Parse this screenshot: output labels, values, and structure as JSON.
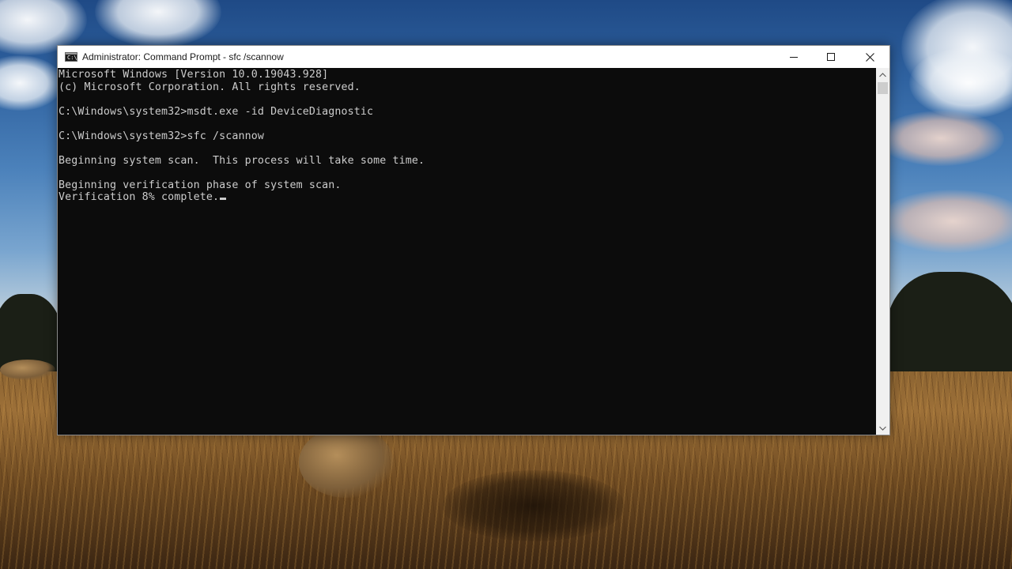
{
  "window": {
    "title": "Administrator: Command Prompt - sfc  /scannow",
    "app_icon_glyph": "C:\\",
    "icons": {
      "app": "command-prompt-icon",
      "minimize": "minimize-icon",
      "maximize": "maximize-icon",
      "close": "close-icon"
    }
  },
  "console": {
    "lines": [
      "Microsoft Windows [Version 10.0.19043.928]",
      "(c) Microsoft Corporation. All rights reserved.",
      "",
      "C:\\Windows\\system32>msdt.exe -id DeviceDiagnostic",
      "",
      "C:\\Windows\\system32>sfc /scannow",
      "",
      "Beginning system scan.  This process will take some time.",
      "",
      "Beginning verification phase of system scan.",
      "Verification 8% complete."
    ],
    "colors": {
      "background": "#0c0c0c",
      "text": "#cccccc"
    }
  },
  "scrollbar": {
    "icons": {
      "up": "scroll-up-arrow-icon",
      "down": "scroll-down-arrow-icon"
    }
  }
}
